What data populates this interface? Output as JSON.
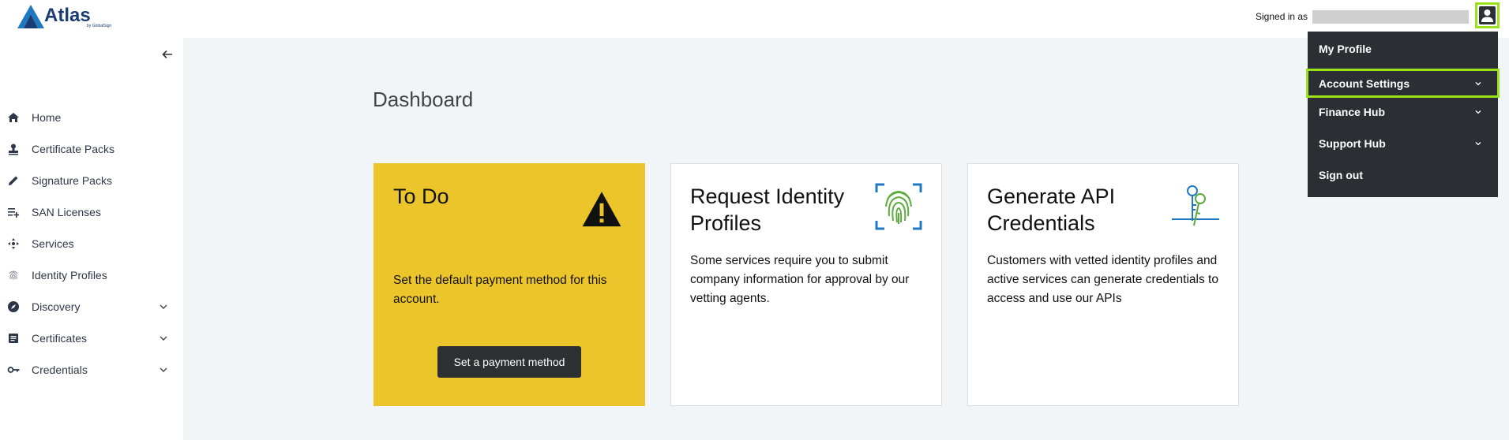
{
  "header": {
    "logo_text": "Atlas",
    "logo_sub": "by GlobalSign",
    "signed_in_label": "Signed in as"
  },
  "sidebar": {
    "items": [
      {
        "label": "Home",
        "icon": "home-icon"
      },
      {
        "label": "Certificate Packs",
        "icon": "stamp-icon"
      },
      {
        "label": "Signature Packs",
        "icon": "pen-icon"
      },
      {
        "label": "SAN Licenses",
        "icon": "playlist-add-icon"
      },
      {
        "label": "Services",
        "icon": "services-icon"
      },
      {
        "label": "Identity Profiles",
        "icon": "fingerprint-icon"
      },
      {
        "label": "Discovery",
        "icon": "compass-icon",
        "expandable": true
      },
      {
        "label": "Certificates",
        "icon": "document-icon",
        "expandable": true
      },
      {
        "label": "Credentials",
        "icon": "key-icon",
        "expandable": true
      }
    ]
  },
  "main": {
    "title": "Dashboard",
    "cards": {
      "todo": {
        "title": "To Do",
        "body": "Set the default payment method for this account.",
        "button": "Set a payment method",
        "icon": "warning-icon"
      },
      "request": {
        "title": "Request Identity Profiles",
        "body": "Some services require you to submit company information for approval by our vetting agents.",
        "icon": "fingerprint-scan-icon"
      },
      "api": {
        "title": "Generate API Credentials",
        "body": "Customers with vetted identity profiles and active services can generate credentials to access and use our APIs",
        "icon": "keys-icon"
      }
    }
  },
  "user_menu": {
    "items": [
      {
        "label": "My Profile"
      },
      {
        "label": "Account Settings",
        "expandable": true
      },
      {
        "label": "Finance Hub",
        "expandable": true
      },
      {
        "label": "Support Hub",
        "expandable": true
      },
      {
        "label": "Sign out"
      }
    ]
  },
  "colors": {
    "todo_bg": "#ecc52b",
    "highlight": "#9be21b",
    "menu_bg": "#2b2e33",
    "main_bg": "#f1f5f7"
  }
}
